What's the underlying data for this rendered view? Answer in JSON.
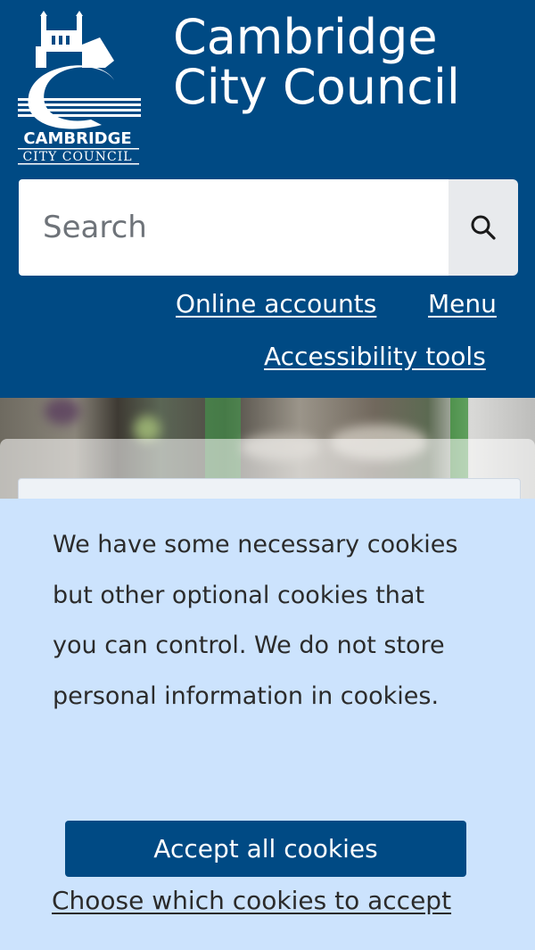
{
  "header": {
    "logo": {
      "wordmark_line1": "CAMBRIDGE",
      "wordmark_line2": "CITY COUNCIL"
    },
    "site_title": "Cambridge City Council"
  },
  "search": {
    "placeholder": "Search",
    "value": "",
    "button_icon": "search-icon"
  },
  "nav": {
    "online_accounts": "Online accounts",
    "menu": "Menu",
    "accessibility_tools": "Accessibility tools"
  },
  "cookie_banner": {
    "message": "We have some necessary cookies but other optional cookies that you can control. We do not store personal information in cookies.",
    "accept_label": "Accept all cookies",
    "choose_label": "Choose which cookies to accept"
  },
  "colors": {
    "header_blue": "#004a84",
    "banner_light_blue": "#cce3fd",
    "button_blue": "#004a84"
  }
}
